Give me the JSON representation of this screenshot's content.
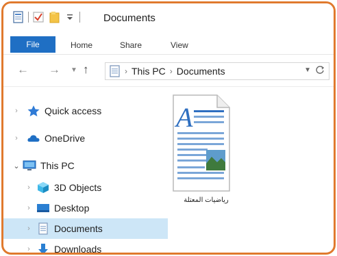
{
  "window": {
    "title": "Documents"
  },
  "ribbon": {
    "file_tab": "File",
    "tabs": [
      "Home",
      "Share",
      "View"
    ]
  },
  "address": {
    "crumbs": [
      "This PC",
      "Documents"
    ]
  },
  "nav": {
    "items": [
      {
        "label": "Quick access",
        "icon": "star-icon"
      },
      {
        "label": "OneDrive",
        "icon": "cloud-icon"
      },
      {
        "label": "This PC",
        "icon": "computer-icon"
      },
      {
        "label": "3D Objects",
        "icon": "cube-icon"
      },
      {
        "label": "Desktop",
        "icon": "desktop-icon"
      },
      {
        "label": "Documents",
        "icon": "document-icon"
      },
      {
        "label": "Downloads",
        "icon": "download-icon"
      }
    ]
  },
  "content": {
    "files": [
      {
        "name": "رياضيات المعتلة",
        "icon": "wordpad-document-icon"
      }
    ]
  },
  "colors": {
    "frame": "#e07a2e",
    "file_tab": "#1f6fc4",
    "selection": "#cde6f7"
  }
}
